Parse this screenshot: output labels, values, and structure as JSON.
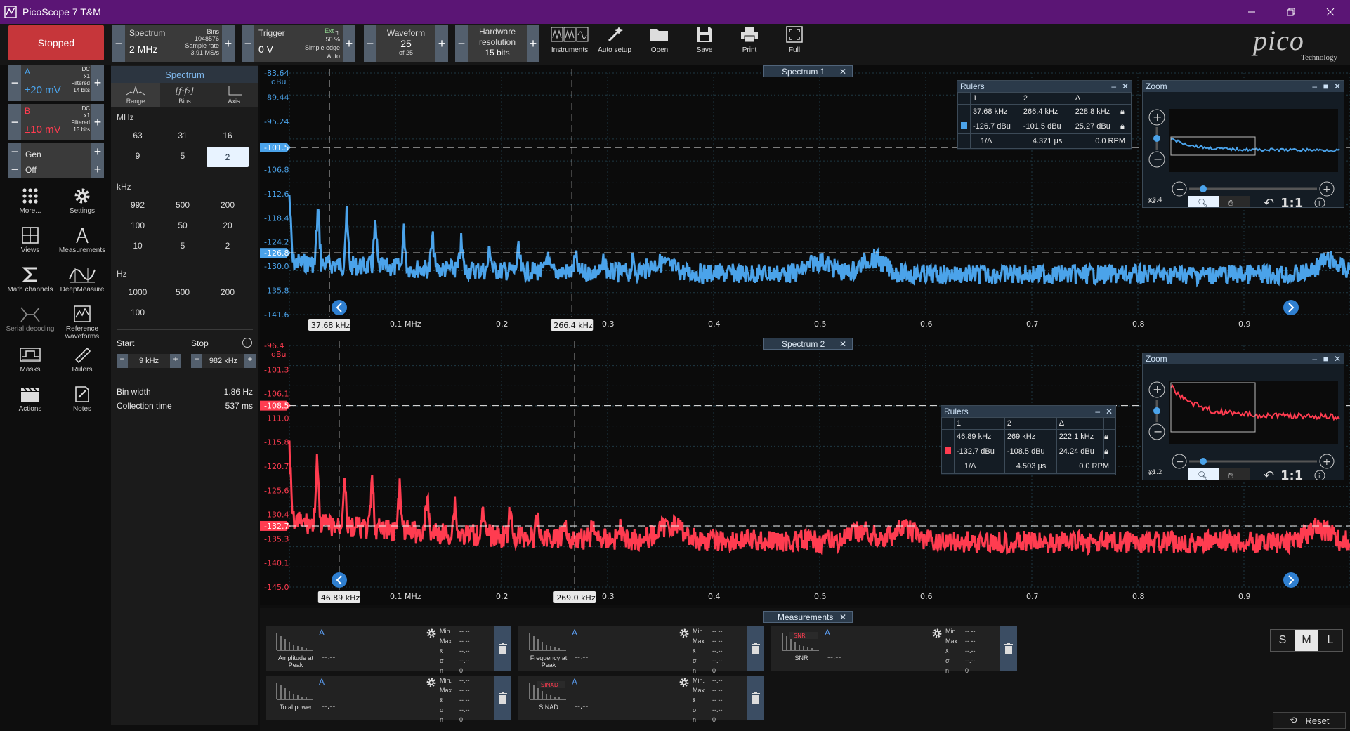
{
  "window": {
    "title": "PicoScope 7 T&M"
  },
  "toolbar": {
    "run_status": "Stopped",
    "spectrum": {
      "label": "Spectrum",
      "value": "2 MHz",
      "bins_label": "Bins",
      "bins": "1048576",
      "sample_rate_label": "Sample rate",
      "sample_rate": "3.91 MS/s"
    },
    "trigger": {
      "label": "Trigger",
      "value": "0 V",
      "source": "Ext",
      "level": "50 %",
      "type": "Simple edge",
      "mode": "Auto"
    },
    "waveform": {
      "label": "Waveform",
      "value": "25",
      "of": "of 25"
    },
    "hardware": {
      "label1": "Hardware",
      "label2": "resolution",
      "value": "15 bits"
    },
    "tools": [
      {
        "label": "Instruments",
        "icon": "instruments-icon"
      },
      {
        "label": "Auto setup",
        "icon": "auto-setup-icon"
      },
      {
        "label": "Open",
        "icon": "folder-icon"
      },
      {
        "label": "Save",
        "icon": "save-icon"
      },
      {
        "label": "Print",
        "icon": "print-icon"
      },
      {
        "label": "Full",
        "icon": "fullscreen-icon"
      }
    ],
    "logo": {
      "name": "pico",
      "sub": "Technology"
    }
  },
  "channels": {
    "a": {
      "name": "A",
      "range": "±20 mV",
      "coupling": "DC",
      "probe": "x1",
      "filter": "Filtered",
      "bits": "14 bits",
      "color": "#4ba3ea"
    },
    "b": {
      "name": "B",
      "range": "±10 mV",
      "coupling": "DC",
      "probe": "x1",
      "filter": "Filtered",
      "bits": "13 bits",
      "color": "#ff3c50"
    },
    "gen": {
      "label": "Gen",
      "state": "Off"
    }
  },
  "left_tools": [
    {
      "label": "More...",
      "icon": "grid-dots-icon"
    },
    {
      "label": "Settings",
      "icon": "gear-icon"
    },
    {
      "label": "Views",
      "icon": "views-icon"
    },
    {
      "label": "Measurements",
      "icon": "measurements-icon"
    },
    {
      "label": "Math channels",
      "icon": "sigma-icon"
    },
    {
      "label": "DeepMeasure",
      "icon": "deepmeasure-icon"
    },
    {
      "label": "Serial decoding",
      "icon": "serial-decoding-icon"
    },
    {
      "label": "Reference waveforms",
      "icon": "reference-waveforms-icon"
    },
    {
      "label": "Masks",
      "icon": "masks-icon"
    },
    {
      "label": "Rulers",
      "icon": "rulers-icon"
    },
    {
      "label": "Actions",
      "icon": "clapper-icon"
    },
    {
      "label": "Notes",
      "icon": "notes-icon"
    }
  ],
  "spectrum_panel": {
    "title": "Spectrum",
    "tabs": [
      "Range",
      "Bins",
      "Axis"
    ],
    "mhz_label": "MHz",
    "mhz": [
      "63",
      "31",
      "16",
      "9",
      "5",
      "2"
    ],
    "selected": "2",
    "khz_label": "kHz",
    "khz": [
      "992",
      "500",
      "200",
      "100",
      "50",
      "20",
      "10",
      "5",
      "2"
    ],
    "hz_label": "Hz",
    "hz": [
      "1000",
      "500",
      "200",
      "100"
    ],
    "start_label": "Start",
    "stop_label": "Stop",
    "start": "9 kHz",
    "stop": "982 kHz",
    "bin_width_label": "Bin width",
    "bin_width": "1.86 Hz",
    "collection_time_label": "Collection time",
    "collection_time": "537 ms"
  },
  "views": [
    {
      "title": "Spectrum 1",
      "unit": "dBu",
      "color": "#4ba3ea",
      "y_ticks": [
        "-83.64",
        "-89.44",
        "-95.24",
        "-101.5",
        "-106.8",
        "-112.6",
        "-118.4",
        "-124.2",
        "-126.8",
        "-130.0",
        "-135.8",
        "-141.6"
      ],
      "x_ticks": [
        "0.1 MHz",
        "0.2",
        "0.3",
        "0.4",
        "0.5",
        "0.6",
        "0.7",
        "0.8",
        "0.9"
      ],
      "ruler_x": [
        "37.68 kHz",
        "266.4 kHz"
      ],
      "ruler_y": [
        "-101.5",
        "-126.8"
      ],
      "rulers": {
        "title": "Rulers",
        "h": [
          "1",
          "2",
          "Δ"
        ],
        "x": [
          "37.68 kHz",
          "266.4 kHz",
          "228.8 kHz"
        ],
        "y": [
          "-126.7 dBu",
          "-101.5 dBu",
          "25.27 dBu"
        ],
        "inv_label": "1/Δ",
        "inv": "4.371 μs",
        "rpm": "0.0 RPM"
      },
      "zoom": {
        "title": "Zoom",
        "x": "x3.4",
        "y": "x2",
        "ratio": "1:1"
      }
    },
    {
      "title": "Spectrum 2",
      "unit": "dBu",
      "color": "#ff3c50",
      "y_ticks": [
        "-96.4",
        "-101.3",
        "-106.1",
        "-108.5",
        "-111.0",
        "-115.8",
        "-120.7",
        "-125.6",
        "-130.4",
        "-132.7",
        "-135.3",
        "-140.1",
        "-145.0"
      ],
      "x_ticks": [
        "0.1 MHz",
        "0.2",
        "0.3",
        "0.4",
        "0.5",
        "0.6",
        "0.7",
        "0.8",
        "0.9"
      ],
      "ruler_x": [
        "46.89 kHz",
        "269.0 kHz"
      ],
      "ruler_y": [
        "-108.5",
        "-132.7"
      ],
      "rulers": {
        "title": "Rulers",
        "h": [
          "1",
          "2",
          "Δ"
        ],
        "x": [
          "46.89 kHz",
          "269 kHz",
          "222.1 kHz"
        ],
        "y": [
          "-132.7 dBu",
          "-108.5 dBu",
          "24.24 dBu"
        ],
        "inv_label": "1/Δ",
        "inv": "4.503 μs",
        "rpm": "0.0 RPM"
      },
      "zoom": {
        "title": "Zoom",
        "x": "x1.2",
        "y": "x2",
        "ratio": "1:1"
      }
    }
  ],
  "measurements": {
    "title": "Measurements",
    "stat_labels": [
      "Min.",
      "Max.",
      "x̄",
      "σ",
      "n"
    ],
    "stat_values": [
      "--.--",
      "--.--",
      "--.--",
      "--.--",
      "0"
    ],
    "items": [
      {
        "label": "Amplitude at Peak",
        "channel": "A",
        "value": "--.--"
      },
      {
        "label": "Frequency at Peak",
        "channel": "A",
        "value": "--.--"
      },
      {
        "label": "SNR",
        "channel": "A",
        "value": "--.--",
        "tag": "SNR"
      },
      {
        "label": "Total power",
        "channel": "A",
        "value": "--.--"
      },
      {
        "label": "SINAD",
        "channel": "A",
        "value": "--.--",
        "tag": "SINAD"
      }
    ]
  },
  "size_buttons": [
    "S",
    "M",
    "L"
  ],
  "size_selected": "M",
  "reset_label": "Reset"
}
